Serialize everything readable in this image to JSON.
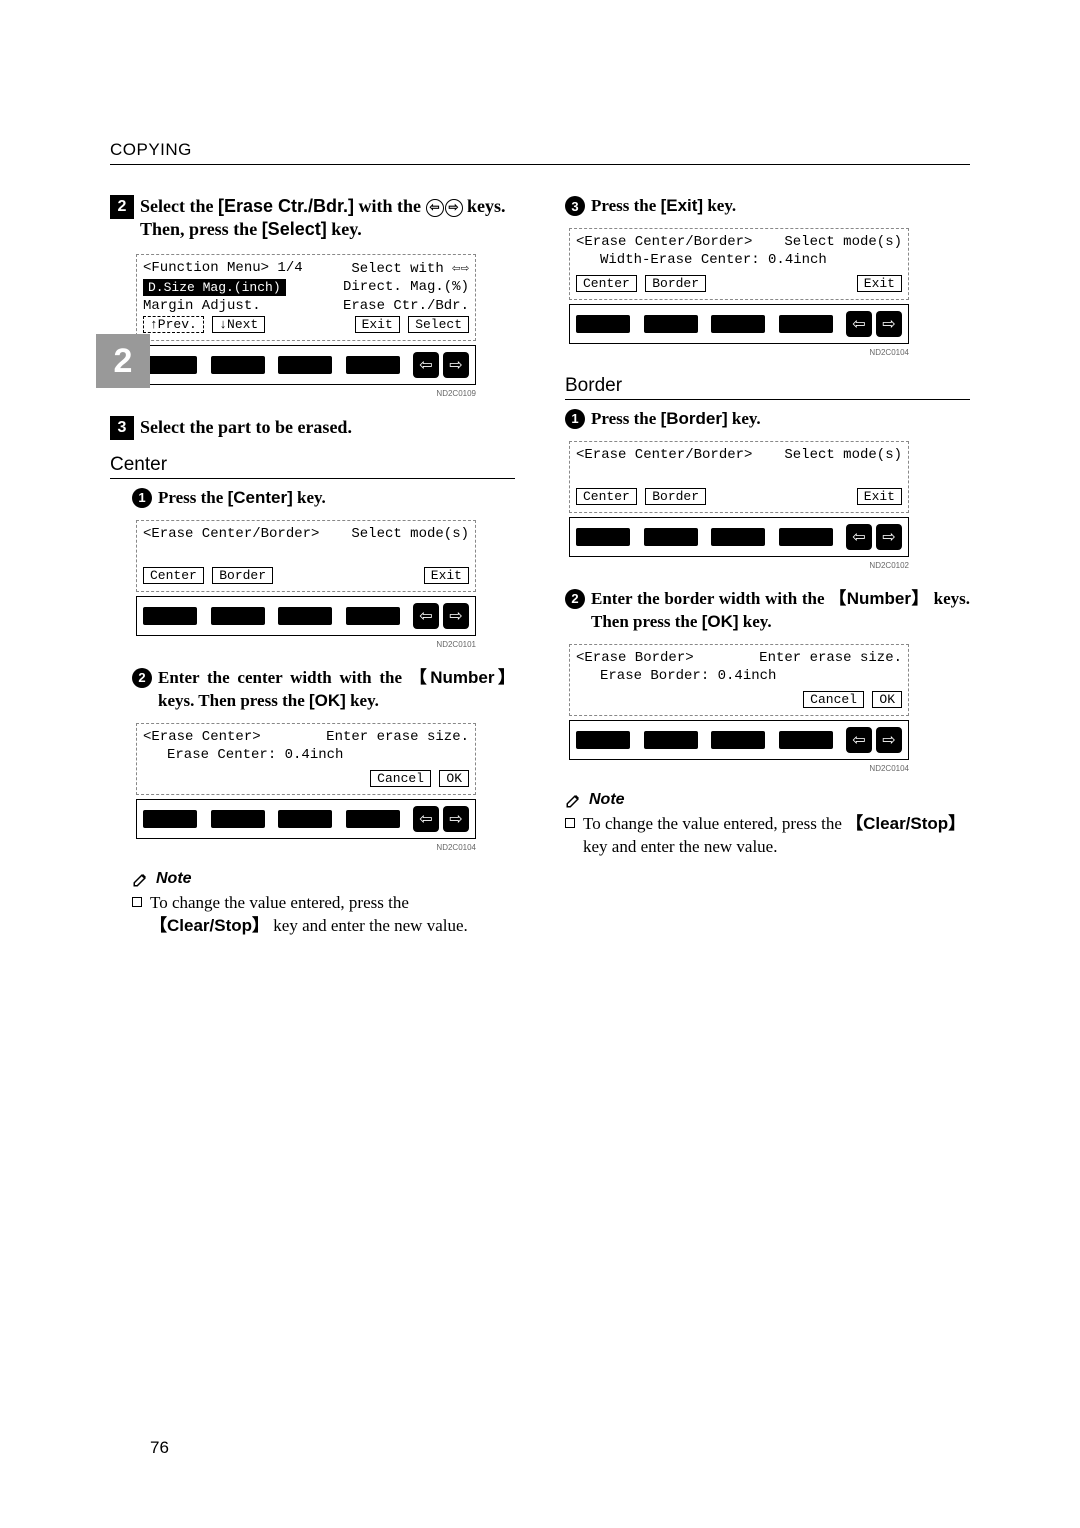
{
  "header": "COPYING",
  "side_tab": "2",
  "page_num": "76",
  "left": {
    "step2": {
      "prefix": "Select the ",
      "key1": "[Erase Ctr./Bdr.]",
      "mid": " with the ",
      "tail": " keys. Then, press the ",
      "key2": "[Select]",
      "end": " key."
    },
    "lcd1": {
      "r1l": "<Function Menu> 1/4",
      "r1r": "Select with ",
      "r2l": "D.Size Mag.(inch)",
      "r2r": "Direct. Mag.(%)",
      "r3l": "Margin Adjust.",
      "r3r": "Erase Ctr./Bdr.",
      "b1": "↑Prev.",
      "b2": "↓Next",
      "b3": "Exit",
      "b4": "Select"
    },
    "cap1": "ND2C0109",
    "step3": "Select the part to be erased.",
    "center_head": "Center",
    "sub1": {
      "prefix": "Press the ",
      "key": "[Center]",
      "tail": " key."
    },
    "lcd2": {
      "r1l": "<Erase Center/Border>",
      "r1r": "Select mode(s)",
      "b1": "Center",
      "b2": "Border",
      "b3": "Exit"
    },
    "cap2": "ND2C0101",
    "sub2": {
      "prefix": "Enter the center width with the ",
      "key": "Number",
      "mid": " keys. Then press the ",
      "key2": "[OK]",
      "tail": " key."
    },
    "lcd3": {
      "r1l": "<Erase Center>",
      "r1r": "Enter erase size.",
      "r2": "Erase Center: 0.4inch",
      "b1": "Cancel",
      "b2": "OK"
    },
    "cap3": "ND2C0104",
    "note": {
      "head": "Note",
      "body_a": "To change the value entered, press the ",
      "key": "Clear/Stop",
      "body_b": " key and enter the new value."
    }
  },
  "right": {
    "sub3": {
      "prefix": "Press the ",
      "key": "[Exit]",
      "tail": " key."
    },
    "lcd4": {
      "r1l": "<Erase Center/Border>",
      "r1r": "Select mode(s)",
      "r2": "Width-Erase Center: 0.4inch",
      "b1": "Center",
      "b2": "Border",
      "b3": "Exit"
    },
    "cap4": "ND2C0104",
    "border_head": "Border",
    "sub4": {
      "prefix": "Press the ",
      "key": "[Border]",
      "tail": " key."
    },
    "lcd5": {
      "r1l": "<Erase Center/Border>",
      "r1r": "Select mode(s)",
      "b1": "Center",
      "b2": "Border",
      "b3": "Exit"
    },
    "cap5": "ND2C0102",
    "sub5": {
      "prefix": "Enter the border width with the ",
      "key": "Number",
      "mid": " keys. Then press the ",
      "key2": "[OK]",
      "tail": " key."
    },
    "lcd6": {
      "r1l": "<Erase Border>",
      "r1r": "Enter erase size.",
      "r2": "Erase Border: 0.4inch",
      "b1": "Cancel",
      "b2": "OK"
    },
    "cap6": "ND2C0104",
    "note": {
      "head": "Note",
      "body_a": "To change the value entered, press the ",
      "key": "Clear/Stop",
      "body_b": " key and enter the new value."
    }
  }
}
